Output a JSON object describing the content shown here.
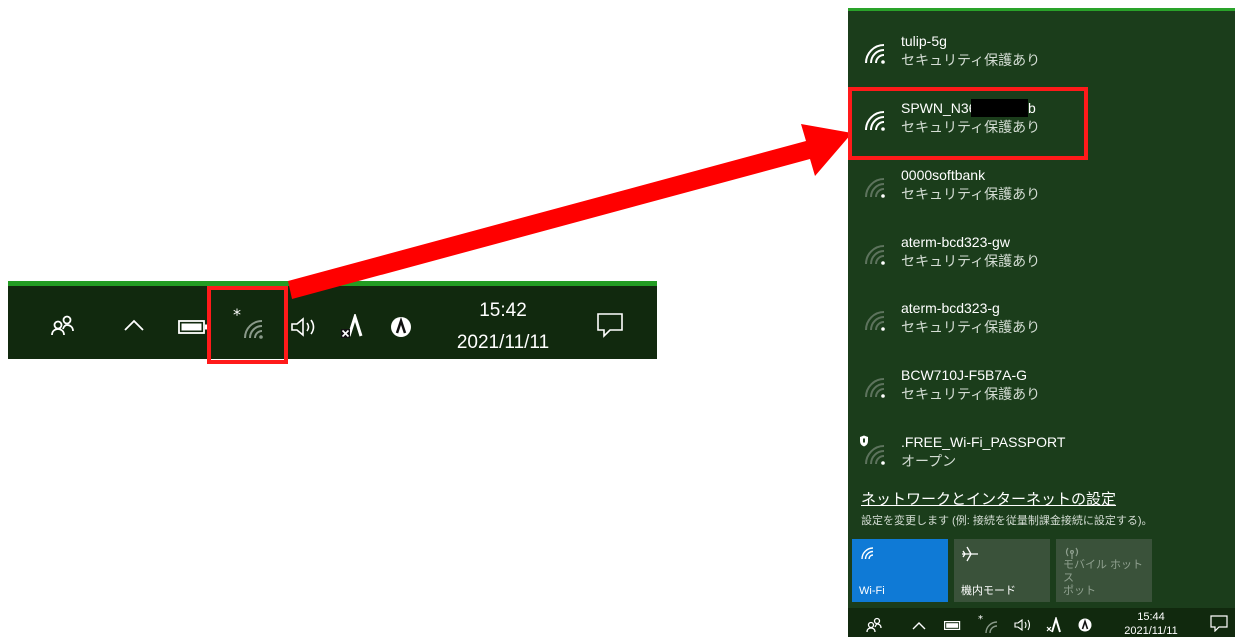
{
  "taskbar": {
    "time": "15:42",
    "date": "2021/11/11",
    "icons": [
      "people-icon",
      "chevron-up-icon",
      "battery-icon",
      "wifi-airplane-icon",
      "volume-icon",
      "app-a-icon",
      "app-circle-icon",
      "action-center-icon"
    ]
  },
  "networks": [
    {
      "ssid": "tulip-5g",
      "security": "セキュリティ保護あり",
      "signal": "strong"
    },
    {
      "ssid": "SPWN_N36_a",
      "ssid_suffix": "b",
      "security": "セキュリティ保護あり",
      "signal": "strong",
      "highlighted": true
    },
    {
      "ssid": "0000softbank",
      "security": "セキュリティ保護あり",
      "signal": "weak"
    },
    {
      "ssid": "aterm-bcd323-gw",
      "security": "セキュリティ保護あり",
      "signal": "weak"
    },
    {
      "ssid": "aterm-bcd323-g",
      "security": "セキュリティ保護あり",
      "signal": "weak"
    },
    {
      "ssid": "BCW710J-F5B7A-G",
      "security": "セキュリティ保護あり",
      "signal": "weak"
    },
    {
      "ssid": ".FREE_Wi-Fi_PASSPORT",
      "security": "オープン",
      "signal": "weak"
    }
  ],
  "settings": {
    "link": "ネットワークとインターネットの設定",
    "sub": "設定を変更します (例: 接続を従量制課金接続に設定する)。"
  },
  "quick_actions": [
    {
      "label": "Wi-Fi",
      "state": "on",
      "icon": "wifi-icon"
    },
    {
      "label": "機内モード",
      "state": "off",
      "icon": "airplane-icon"
    },
    {
      "label": "モバイル ホットス\nポット",
      "state": "disabled",
      "icon": "hotspot-icon"
    }
  ],
  "taskbar_small": {
    "time": "15:44",
    "date": "2021/11/11"
  },
  "colors": {
    "taskbar_bg": "#11290e",
    "accent_green": "#239c23",
    "flyout_bg": "#1b3d1b",
    "wifi_tile": "#0f7ad6",
    "highlight_red": "#ff1a1a"
  }
}
